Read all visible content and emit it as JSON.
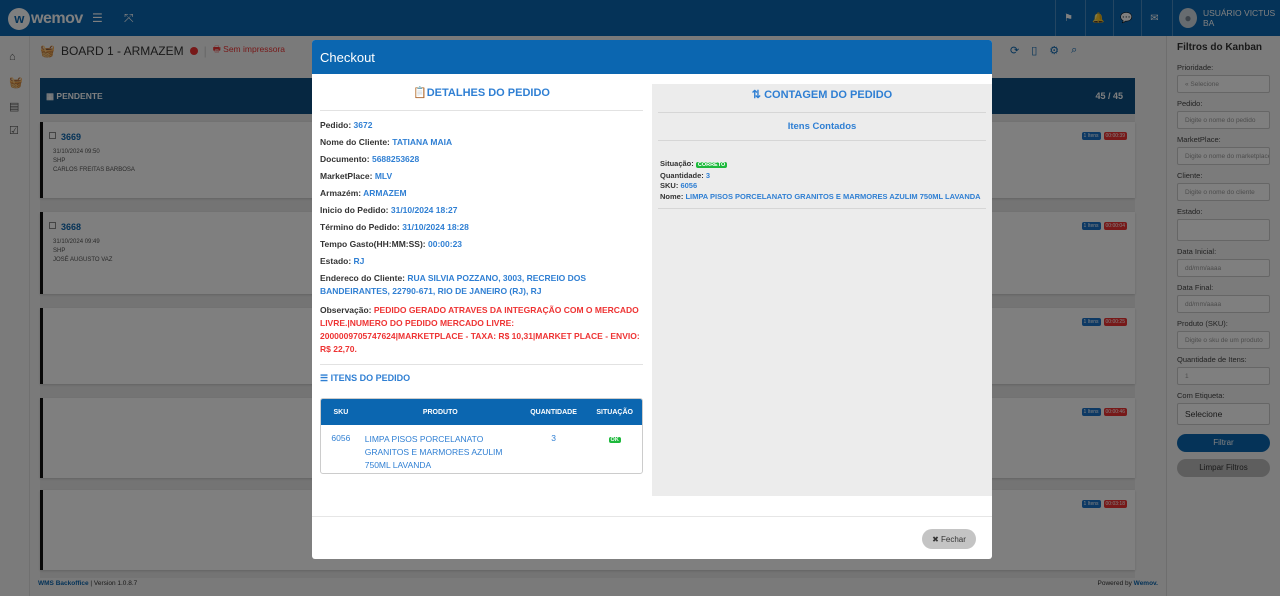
{
  "app": {
    "logo": "wemov",
    "user": "USUÁRIO VICTUS BA"
  },
  "board": {
    "title": "BOARD 1 - ARMAZEM",
    "printer": "Sem impressora",
    "column": "PENDENTE",
    "count": "45 / 45"
  },
  "cards": [
    {
      "number": "3669",
      "date": "31/10/2024 09:50",
      "carrier": "SHP",
      "client": "CARLOS FREITAS BARBOSA",
      "items": "1 Itens",
      "timer": "00:00:39"
    },
    {
      "number": "3668",
      "date": "31/10/2024 09:49",
      "carrier": "SHP",
      "client": "JOSÉ AUGUSTO VAZ",
      "items": "1 Itens",
      "timer": "00:00:04"
    },
    {
      "items": "1 Itens",
      "timer": "00:00:25"
    },
    {
      "items": "1 Itens",
      "timer": "00:00:46"
    },
    {
      "items": "1 Itens",
      "timer": "00:03:18"
    }
  ],
  "footer": {
    "left_name": "WMS Backoffice",
    "left_version": "| Version 1.0.8.7",
    "right_prefix": "Powered by",
    "right_brand": "Wemov."
  },
  "filters": {
    "title": "Filtros do Kanban",
    "fields": [
      {
        "label": "Prioridade:",
        "value": "« Selecione"
      },
      {
        "label": "Pedido:",
        "value": "Digite o nome do pedido"
      },
      {
        "label": "MarketPlace:",
        "value": "Digite o nome do marketplace"
      },
      {
        "label": "Cliente:",
        "value": "Digite o nome do cliente"
      },
      {
        "label": "Estado:",
        "value": ""
      },
      {
        "label": "Data Inicial:",
        "value": "dd/mm/aaaa"
      },
      {
        "label": "Data Final:",
        "value": "dd/mm/aaaa"
      },
      {
        "label": "Produto (SKU):",
        "value": "Digite o sku de um produto"
      },
      {
        "label": "Quantidade de Itens:",
        "value": "1"
      },
      {
        "label": "Com Etiqueta:",
        "value": "Selecione"
      }
    ],
    "filter_btn": "Filtrar",
    "clear_btn": "Limpar Filtros"
  },
  "modal": {
    "title": "Checkout",
    "details_title": "DETALHES DO PEDIDO",
    "count_title": "CONTAGEM DO PEDIDO",
    "fields": [
      {
        "label": "Pedido:",
        "value": "3672"
      },
      {
        "label": "Nome do Cliente:",
        "value": "TATIANA MAIA"
      },
      {
        "label": "Documento:",
        "value": "5688253628"
      },
      {
        "label": "MarketPlace:",
        "value": "MLV"
      },
      {
        "label": "Armazém:",
        "value": "ARMAZEM"
      },
      {
        "label": "Inicio do Pedido:",
        "value": "31/10/2024 18:27"
      },
      {
        "label": "Término do Pedido:",
        "value": "31/10/2024 18:28"
      },
      {
        "label": "Tempo Gasto(HH:MM:SS):",
        "value": "00:00:23"
      },
      {
        "label": "Estado:",
        "value": "RJ"
      },
      {
        "label": "Endereco do Cliente:",
        "value": "RUA SILVIA POZZANO, 3003, RECREIO DOS BANDEIRANTES, 22790-671, RIO DE JANEIRO (RJ), RJ"
      }
    ],
    "obs_label": "Observação:",
    "obs_value": "PEDIDO GERADO ATRAVES DA INTEGRAÇÃO COM O MERCADO LIVRE.|NUMERO DO PEDIDO MERCADO LIVRE: 2000009705747624|MARKETPLACE - TAXA: R$ 10,31|MARKET PLACE - ENVIO: R$ 22,70.",
    "items_title": "ITENS DO PEDIDO",
    "table_headers": [
      "SKU",
      "PRODUTO",
      "QUANTIDADE",
      "SITUAÇÃO"
    ],
    "table_row": {
      "sku": "6056",
      "product": "LIMPA PISOS PORCELANATO GRANITOS E MARMORES AZULIM 750ML LAVANDA",
      "qty": "3",
      "status": "OK"
    },
    "counted_title": "Itens Contados",
    "counted": {
      "status_label": "Situação:",
      "status": "CORRETO",
      "qty_label": "Quantidade:",
      "qty": "3",
      "sku_label": "SKU:",
      "sku": "6056",
      "name_label": "Nome:",
      "name": "LIMPA PISOS PORCELANATO GRANITOS E MARMORES AZULIM 750ML LAVANDA"
    },
    "close_btn": "Fechar"
  },
  "colors": {
    "primary": "#0b66b0",
    "accent_text": "#2f7fd3",
    "danger": "#e33333",
    "success": "#1db93c"
  }
}
